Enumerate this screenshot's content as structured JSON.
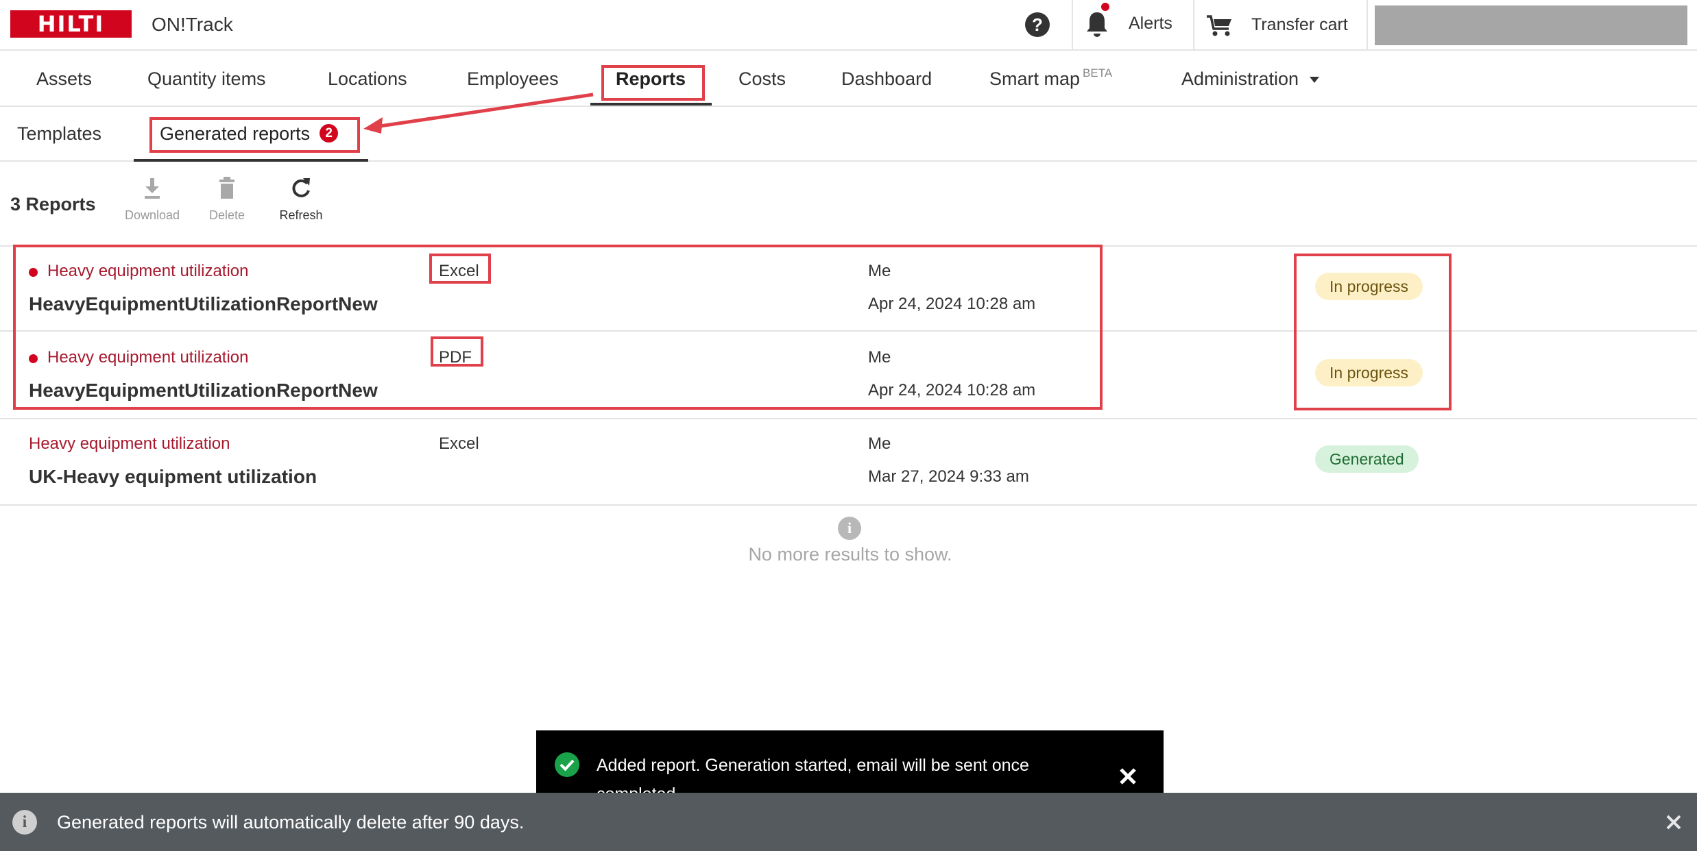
{
  "header": {
    "logo_text": "HILTI",
    "app_name": "ON!Track",
    "help_label": "?",
    "alerts_label": "Alerts",
    "transfer_cart_label": "Transfer cart"
  },
  "main_nav": {
    "items": [
      {
        "label": "Assets"
      },
      {
        "label": "Quantity items"
      },
      {
        "label": "Locations"
      },
      {
        "label": "Employees"
      },
      {
        "label": "Reports"
      },
      {
        "label": "Costs"
      },
      {
        "label": "Dashboard"
      },
      {
        "label": "Smart map",
        "badge": "BETA"
      },
      {
        "label": "Administration"
      }
    ],
    "active": "Reports"
  },
  "sub_nav": {
    "templates_label": "Templates",
    "generated_label": "Generated reports",
    "generated_count": "2"
  },
  "toolbar": {
    "reports_count": "3 Reports",
    "download_label": "Download",
    "delete_label": "Delete",
    "refresh_label": "Refresh"
  },
  "reports": [
    {
      "template": "Heavy equipment utilization",
      "name": "HeavyEquipmentUtilizationReportNew",
      "format": "Excel",
      "owner": "Me",
      "date": "Apr 24, 2024 10:28 am",
      "status": "In progress",
      "unread": true
    },
    {
      "template": "Heavy equipment utilization",
      "name": "HeavyEquipmentUtilizationReportNew",
      "format": "PDF",
      "owner": "Me",
      "date": "Apr 24, 2024 10:28 am",
      "status": "In progress",
      "unread": true
    },
    {
      "template": "Heavy equipment utilization",
      "name": "UK-Heavy equipment utilization",
      "format": "Excel",
      "owner": "Me",
      "date": "Mar 27, 2024 9:33 am",
      "status": "Generated",
      "unread": false
    }
  ],
  "end_of_list": {
    "icon_glyph": "i",
    "text": "No more results to show."
  },
  "toast": {
    "message": "Added report. Generation started, email will be sent once completed."
  },
  "info_bar": {
    "icon_glyph": "i",
    "text": "Generated reports will automatically delete after 90 days."
  },
  "colors": {
    "brand_red": "#d2051e",
    "annotation_red": "#e0404a",
    "in_progress_bg": "#fdf0c6",
    "generated_bg": "#d7f2dc"
  }
}
